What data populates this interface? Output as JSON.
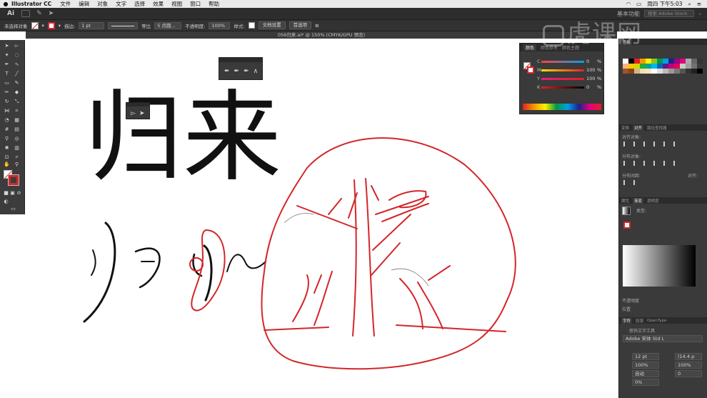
{
  "mac_menu": {
    "app_name": "Illustrator CC",
    "items": [
      "文件",
      "编辑",
      "对象",
      "文字",
      "选择",
      "效果",
      "视图",
      "窗口",
      "帮助"
    ],
    "clock": "周四 下午5:03"
  },
  "app_bar": {
    "logo": "Ai",
    "workspace": "基本功能",
    "search_placeholder": "搜索 Adobe Stock"
  },
  "control_bar": {
    "selection_label": "未选择对象",
    "stroke_label": "描边:",
    "stroke_weight": "1 pt",
    "line_style": "等比",
    "brush": "5 点圆...",
    "opacity_label": "不透明度:",
    "opacity_value": "100%",
    "style_label": "样式:",
    "doc_setup_button": "文档设置",
    "preferences_button": "首选项"
  },
  "document_tab": {
    "title": "056归来.ai* @ 150% (CMYK/GPU 预览)"
  },
  "canvas": {
    "headline": "归来",
    "stroke_color": "#d3262a",
    "ink_color": "#111111"
  },
  "color_panel": {
    "tabs": [
      "颜色",
      "颜色参考",
      "颜色主题"
    ],
    "channels": [
      {
        "name": "C",
        "value": "0",
        "unit": "%"
      },
      {
        "name": "M",
        "value": "100",
        "unit": "%"
      },
      {
        "name": "Y",
        "value": "100",
        "unit": "%"
      },
      {
        "name": "K",
        "value": "0",
        "unit": "%"
      }
    ]
  },
  "right_dock": {
    "swatches_tab": "色板",
    "align_tabs": [
      "变换",
      "对齐",
      "路径查找器"
    ],
    "align_objects_label": "对齐对象:",
    "distribute_objects_label": "分布对象:",
    "distribute_spacing_label": "分布间距:",
    "align_to_label": "对齐:",
    "appearance_tabs": [
      "属性",
      "渐变",
      "透明度"
    ],
    "gradient_type_label": "类型:",
    "gradient_extra": "不透明度",
    "gradient_position": "位置",
    "type_tabs": [
      "字符",
      "段落",
      "OpenType"
    ],
    "type_tool_label": "修饰文字工具",
    "font_name": "Adobe 宋体 Std L",
    "font_size": "12 pt",
    "leading": "(14.4 p",
    "scale_h": "100%",
    "scale_v": "100%",
    "kerning": "自动",
    "tracking": "0",
    "baseline": "0%"
  },
  "watermark": "虎课网"
}
